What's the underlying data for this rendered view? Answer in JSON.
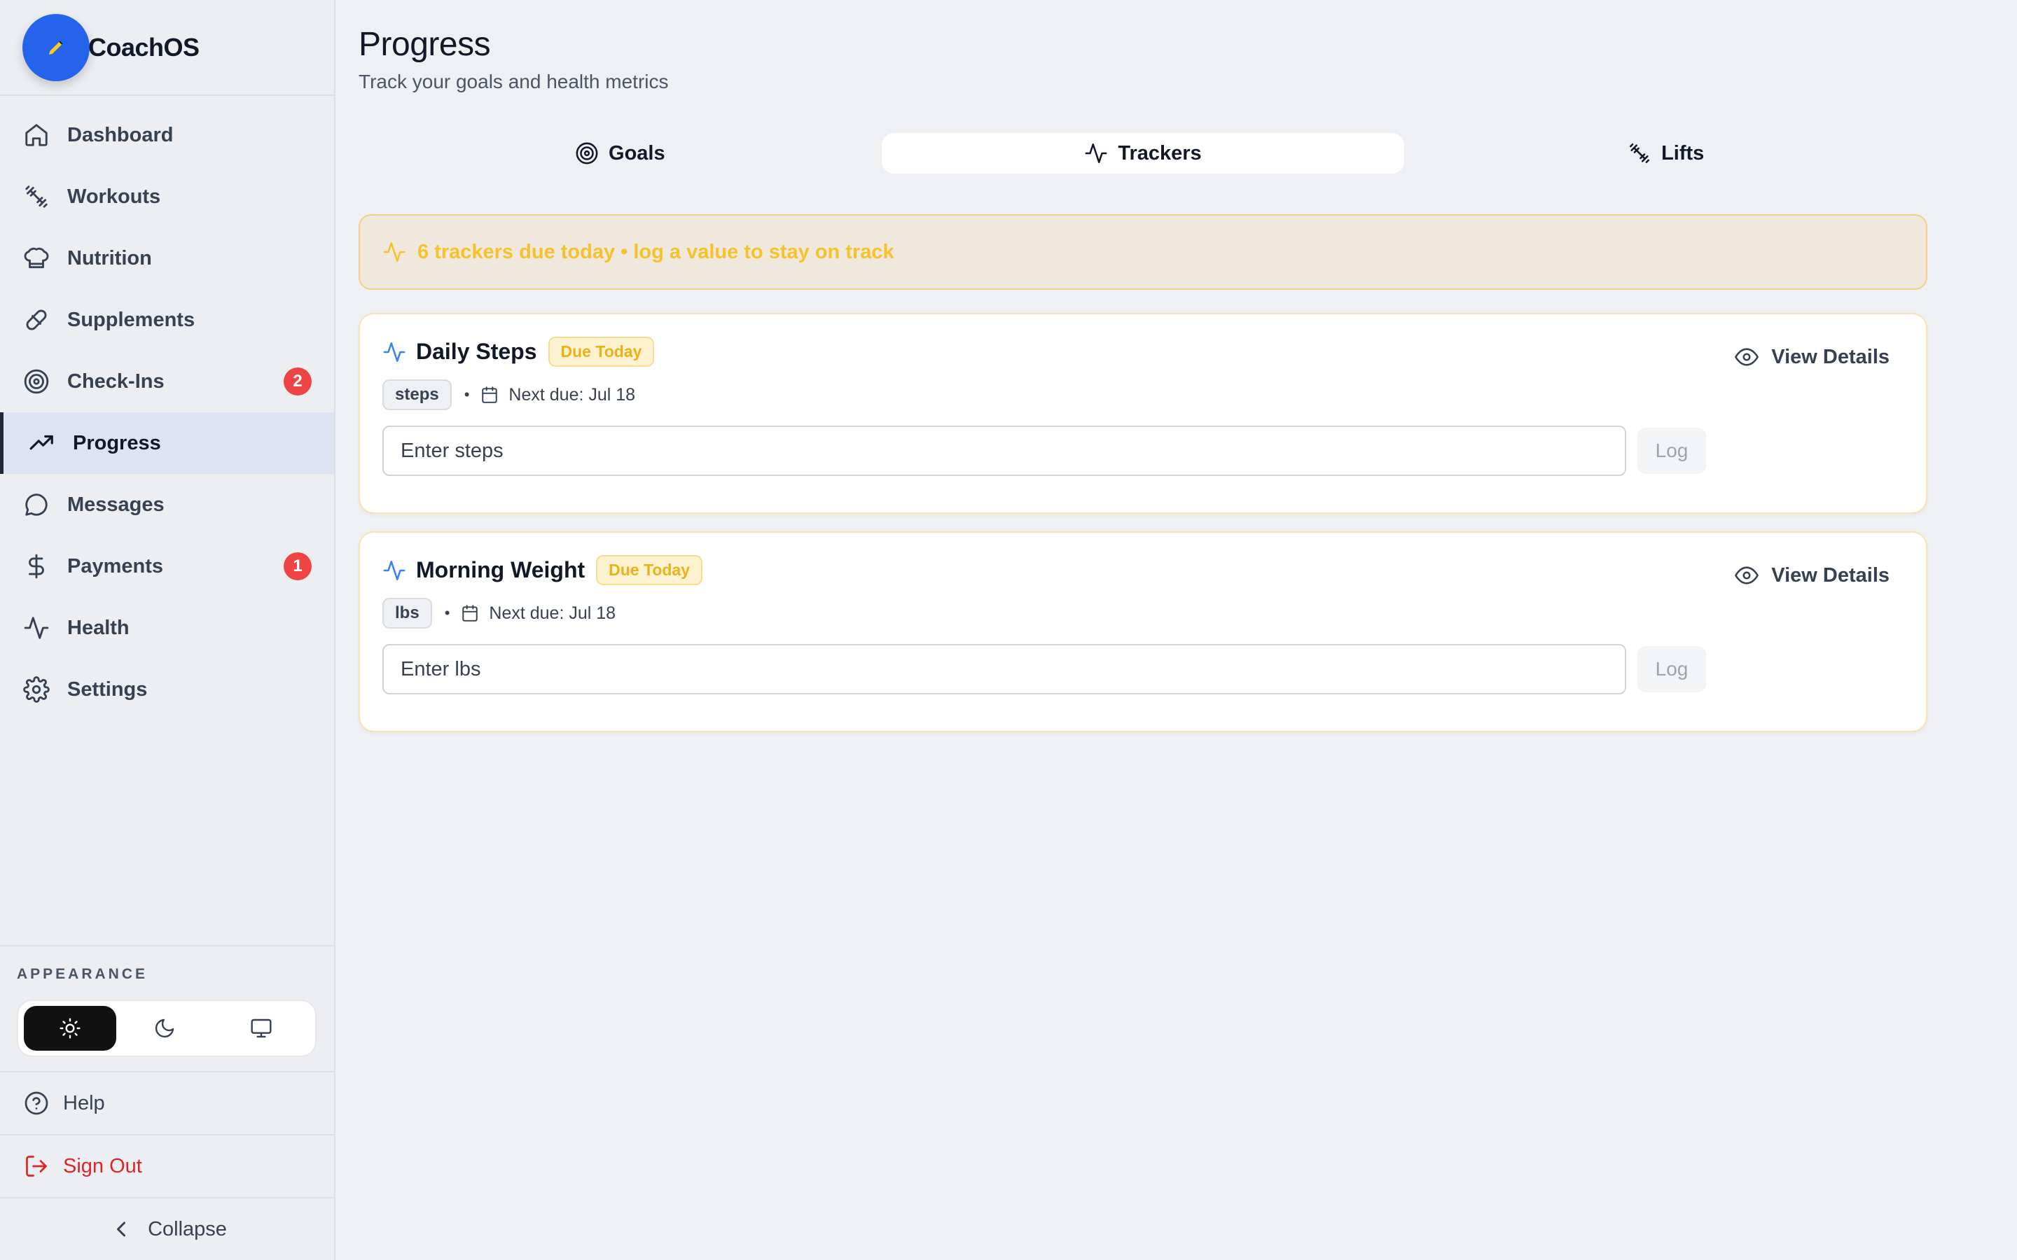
{
  "app": {
    "name": "CoachOS"
  },
  "sidebar": {
    "items": [
      {
        "label": "Dashboard",
        "icon": "home-icon"
      },
      {
        "label": "Workouts",
        "icon": "dumbbell-icon"
      },
      {
        "label": "Nutrition",
        "icon": "chef-hat-icon"
      },
      {
        "label": "Supplements",
        "icon": "pill-icon"
      },
      {
        "label": "Check-Ins",
        "icon": "target-icon",
        "badge": "2"
      },
      {
        "label": "Progress",
        "icon": "trending-up-icon",
        "active": true
      },
      {
        "label": "Messages",
        "icon": "message-icon"
      },
      {
        "label": "Payments",
        "icon": "dollar-icon",
        "badge": "1"
      },
      {
        "label": "Health",
        "icon": "activity-icon"
      },
      {
        "label": "Settings",
        "icon": "gear-icon"
      }
    ],
    "appearance_label": "APPEARANCE",
    "theme": {
      "selected": "light",
      "options": [
        "light",
        "dark",
        "system"
      ]
    },
    "help_label": "Help",
    "signout_label": "Sign Out",
    "collapse_label": "Collapse"
  },
  "page": {
    "title": "Progress",
    "subtitle": "Track your goals and health metrics"
  },
  "tabs": [
    {
      "label": "Goals",
      "icon": "target-icon"
    },
    {
      "label": "Trackers",
      "icon": "activity-icon",
      "active": true
    },
    {
      "label": "Lifts",
      "icon": "dumbbell-icon"
    }
  ],
  "banner": {
    "text": "6 trackers due today • log a value to stay on track"
  },
  "trackers": [
    {
      "title": "Daily Steps",
      "badge": "Due Today",
      "unit": "steps",
      "next_due": "Next due: Jul 18",
      "placeholder": "Enter steps",
      "log_label": "Log",
      "details_label": "View Details"
    },
    {
      "title": "Morning Weight",
      "badge": "Due Today",
      "unit": "lbs",
      "next_due": "Next due: Jul 18",
      "placeholder": "Enter lbs",
      "log_label": "Log",
      "details_label": "View Details"
    }
  ],
  "colors": {
    "accent": "#2563eb",
    "badge_red": "#ef4444",
    "warning_text": "#f6c22b",
    "danger": "#dc2626"
  }
}
